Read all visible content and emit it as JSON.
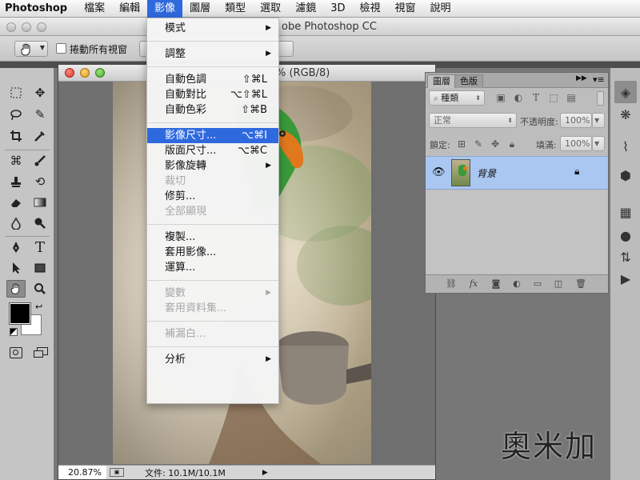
{
  "menubar": {
    "app": "Photoshop",
    "items": [
      "檔案",
      "編輯",
      "影像",
      "圖層",
      "類型",
      "選取",
      "濾鏡",
      "3D",
      "檢視",
      "視窗",
      "說明"
    ],
    "active": "影像"
  },
  "app_title": "obe Photoshop CC",
  "options_bar": {
    "hand_icon": "hand-icon",
    "scroll_all_label": "捲動所有視窗"
  },
  "document": {
    "title": "% (RGB/8)",
    "zoom": "20.87%",
    "file_info": "文件: 10.1M/10.1M"
  },
  "image_menu": {
    "items": [
      {
        "label": "模式",
        "shortcut": "",
        "submenu": true,
        "disabled": false,
        "highlighted": false
      },
      {
        "separator": true
      },
      {
        "label": "調整",
        "shortcut": "",
        "submenu": true,
        "disabled": false,
        "highlighted": false
      },
      {
        "separator": true
      },
      {
        "label": "自動色調",
        "shortcut": "⇧⌘L",
        "submenu": false,
        "disabled": false,
        "highlighted": false
      },
      {
        "label": "自動對比",
        "shortcut": "⌥⇧⌘L",
        "submenu": false,
        "disabled": false,
        "highlighted": false
      },
      {
        "label": "自動色彩",
        "shortcut": "⇧⌘B",
        "submenu": false,
        "disabled": false,
        "highlighted": false
      },
      {
        "separator": true
      },
      {
        "label": "影像尺寸...",
        "shortcut": "⌥⌘I",
        "submenu": false,
        "disabled": false,
        "highlighted": true
      },
      {
        "label": "版面尺寸...",
        "shortcut": "⌥⌘C",
        "submenu": false,
        "disabled": false,
        "highlighted": false
      },
      {
        "label": "影像旋轉",
        "shortcut": "",
        "submenu": true,
        "disabled": false,
        "highlighted": false
      },
      {
        "label": "裁切",
        "shortcut": "",
        "submenu": false,
        "disabled": true,
        "highlighted": false
      },
      {
        "label": "修剪...",
        "shortcut": "",
        "submenu": false,
        "disabled": false,
        "highlighted": false
      },
      {
        "label": "全部顯現",
        "shortcut": "",
        "submenu": false,
        "disabled": true,
        "highlighted": false
      },
      {
        "separator": true
      },
      {
        "label": "複製...",
        "shortcut": "",
        "submenu": false,
        "disabled": false,
        "highlighted": false
      },
      {
        "label": "套用影像...",
        "shortcut": "",
        "submenu": false,
        "disabled": false,
        "highlighted": false
      },
      {
        "label": "運算...",
        "shortcut": "",
        "submenu": false,
        "disabled": false,
        "highlighted": false
      },
      {
        "separator": true
      },
      {
        "label": "變數",
        "shortcut": "",
        "submenu": true,
        "disabled": true,
        "highlighted": false
      },
      {
        "label": "套用資料集...",
        "shortcut": "",
        "submenu": false,
        "disabled": true,
        "highlighted": false
      },
      {
        "separator": true
      },
      {
        "label": "補漏白...",
        "shortcut": "",
        "submenu": false,
        "disabled": true,
        "highlighted": false
      },
      {
        "separator": true
      },
      {
        "label": "分析",
        "shortcut": "",
        "submenu": true,
        "disabled": false,
        "highlighted": false
      }
    ]
  },
  "layers_panel": {
    "tabs": [
      "圖層",
      "色版"
    ],
    "filter_kind": "種類",
    "blend_mode": "正常",
    "opacity_label": "不透明度:",
    "opacity_value": "100%",
    "lock_label": "鎖定:",
    "fill_label": "填滿:",
    "fill_value": "100%",
    "layer_name": "背景"
  },
  "watermark": "奧米加",
  "colors": {
    "menu_highlight": "#2f69de",
    "layer_selected": "#a9c7f1"
  }
}
